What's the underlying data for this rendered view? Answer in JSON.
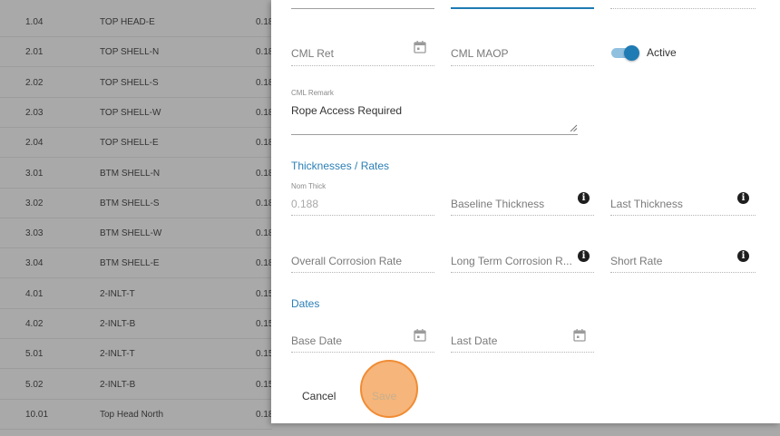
{
  "table": {
    "rows": [
      {
        "id": "1.04",
        "name": "TOP HEAD-E",
        "val": "0.18"
      },
      {
        "id": "2.01",
        "name": "TOP SHELL-N",
        "val": "0.18"
      },
      {
        "id": "2.02",
        "name": "TOP SHELL-S",
        "val": "0.18"
      },
      {
        "id": "2.03",
        "name": "TOP SHELL-W",
        "val": "0.18"
      },
      {
        "id": "2.04",
        "name": "TOP SHELL-E",
        "val": "0.18"
      },
      {
        "id": "3.01",
        "name": "BTM SHELL-N",
        "val": "0.18"
      },
      {
        "id": "3.02",
        "name": "BTM SHELL-S",
        "val": "0.18"
      },
      {
        "id": "3.03",
        "name": "BTM SHELL-W",
        "val": "0.18"
      },
      {
        "id": "3.04",
        "name": "BTM SHELL-E",
        "val": "0.18"
      },
      {
        "id": "4.01",
        "name": "2-INLT-T",
        "val": "0.15"
      },
      {
        "id": "4.02",
        "name": "2-INLT-B",
        "val": "0.15"
      },
      {
        "id": "5.01",
        "name": "2-INLT-T",
        "val": "0.15"
      },
      {
        "id": "5.02",
        "name": "2-INLT-B",
        "val": "0.15"
      },
      {
        "id": "10.01",
        "name": "Top Head North",
        "val": "0.18"
      }
    ]
  },
  "dialog": {
    "cml_ret_label": "CML Ret",
    "cml_maop_label": "CML MAOP",
    "active_label": "Active",
    "active_on": true,
    "cml_remark_label": "CML Remark",
    "cml_remark_value": "Rope Access Required",
    "thickness_section": "Thicknesses / Rates",
    "nom_thick_label": "Nom Thick",
    "nom_thick_value": "0.188",
    "baseline_thickness_label": "Baseline Thickness",
    "last_thickness_label": "Last Thickness",
    "overall_corrosion_label": "Overall Corrosion Rate",
    "long_term_corrosion_label": "Long Term Corrosion R...",
    "short_rate_label": "Short Rate",
    "dates_section": "Dates",
    "base_date_label": "Base Date",
    "last_date_label": "Last Date",
    "cancel_label": "Cancel",
    "save_label": "Save",
    "accent_color": "#1f7bb3",
    "highlight_color": "#f6b57a"
  }
}
